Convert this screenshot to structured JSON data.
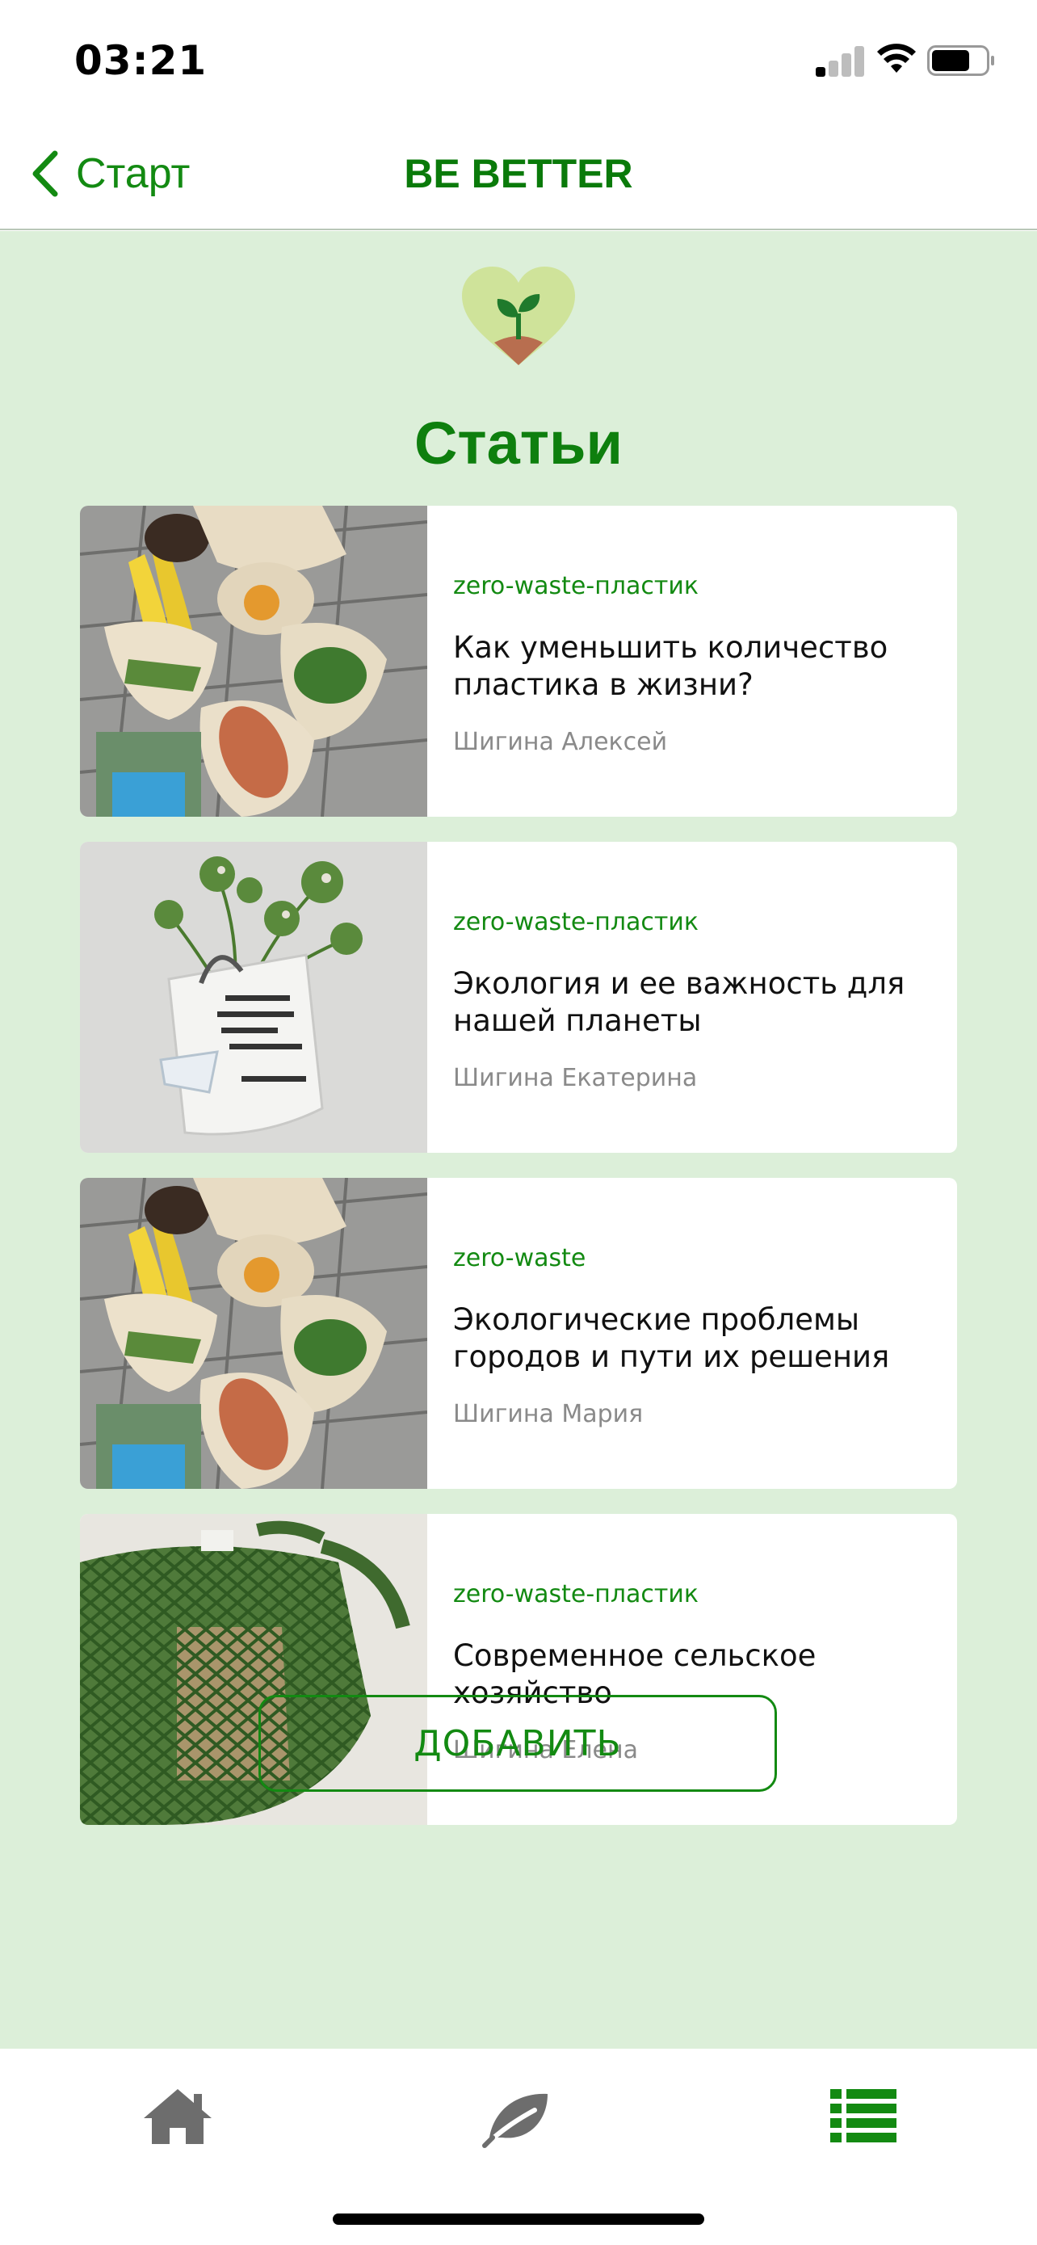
{
  "status": {
    "time": "03:21"
  },
  "nav": {
    "back_label": "Старт",
    "title": "BE BETTER"
  },
  "page": {
    "title": "Статьи"
  },
  "articles": [
    {
      "tag": "zero-waste-пластик",
      "title": "Как уменьшить количество пластика в жизни?",
      "author": "Шигина Алексей"
    },
    {
      "tag": "zero-waste-пластик",
      "title": "Экология и ее важность для нашей планеты",
      "author": "Шигина Екатерина"
    },
    {
      "tag": "zero-waste",
      "title": "Экологические проблемы городов и пути их решения",
      "author": "Шигина Мария"
    },
    {
      "tag": "zero-waste-пластик",
      "title": "Современное сельское хозяйство",
      "author": "Шигина Елена"
    }
  ],
  "add_button": {
    "label": "ДОБАВИТЬ"
  },
  "tabs": [
    {
      "icon": "home-icon",
      "active": false
    },
    {
      "icon": "leaf-icon",
      "active": false
    },
    {
      "icon": "list-icon",
      "active": true
    }
  ],
  "colors": {
    "accent": "#138a12",
    "background": "#dcefd9",
    "inactive_icon": "#6d6d6d"
  }
}
